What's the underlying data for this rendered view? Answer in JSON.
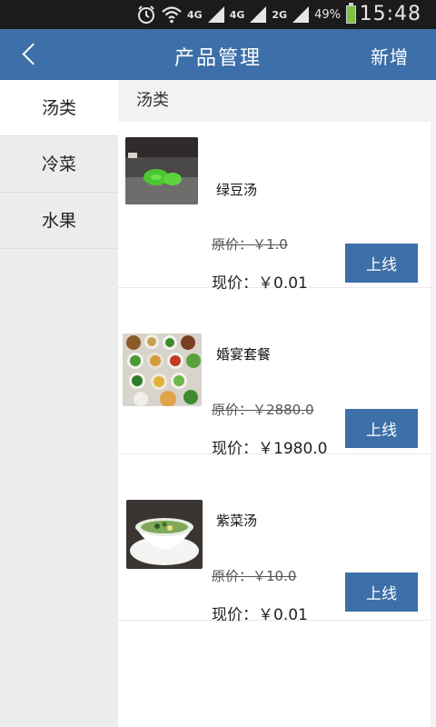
{
  "status_bar": {
    "net1": "4G",
    "net2": "4G",
    "net3": "2G",
    "battery": "49%",
    "time": "15:48",
    "icons": [
      "alarm-icon",
      "wifi-icon",
      "signal-icon",
      "battery-icon"
    ]
  },
  "header": {
    "title": "产品管理",
    "action": "新增"
  },
  "sidebar": {
    "items": [
      {
        "label": "汤类"
      },
      {
        "label": "冷菜"
      },
      {
        "label": "水果"
      }
    ]
  },
  "main": {
    "section_title": "汤类",
    "products": [
      {
        "name": "绿豆汤",
        "original_price": "原价：￥1.0",
        "current_price": "现价：￥0.01",
        "button": "上线"
      },
      {
        "name": "婚宴套餐",
        "original_price": "原价：￥2880.0",
        "current_price": "现价：￥1980.0",
        "button": "上线"
      },
      {
        "name": "紫菜汤",
        "original_price": "原价：￥10.0",
        "current_price": "现价：￥0.01",
        "button": "上线"
      }
    ]
  },
  "colors": {
    "header_bg": "#3d6fa8",
    "button_bg": "#3d6fa8",
    "status_bar_bg": "#1b1b1b",
    "sidebar_bg": "#ececec"
  }
}
